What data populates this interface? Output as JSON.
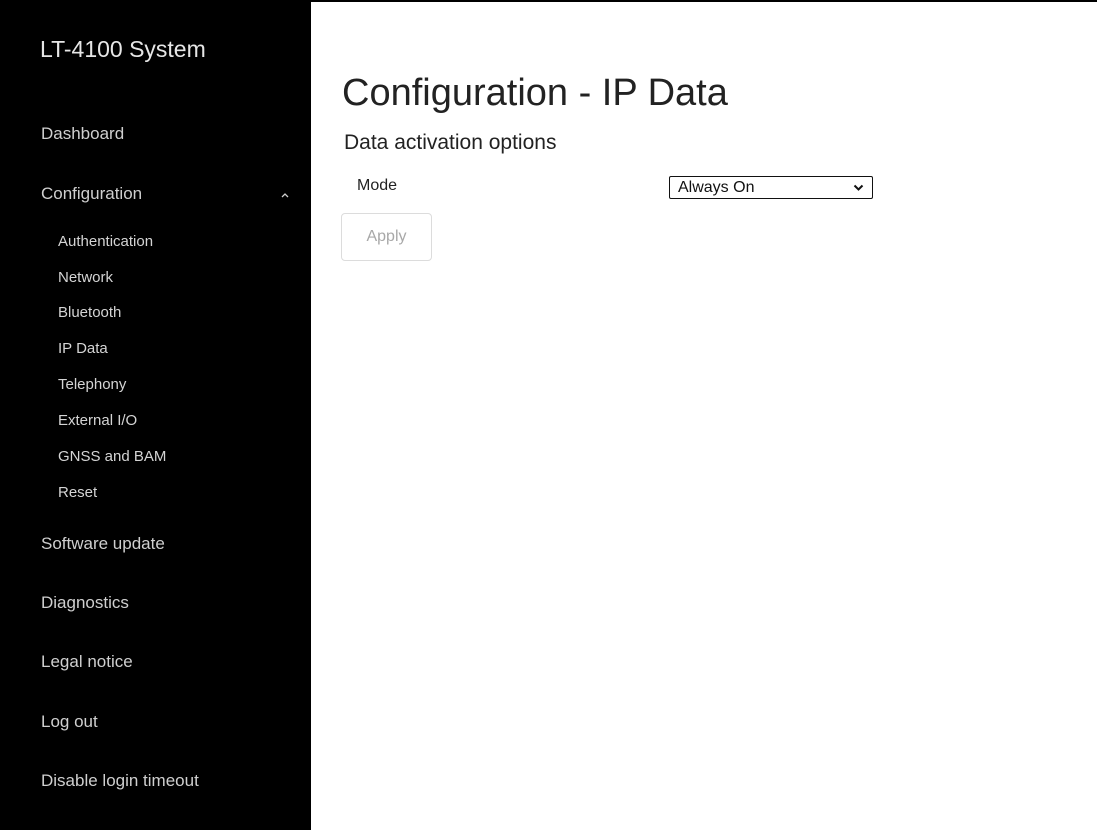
{
  "sidebar": {
    "brand": "LT-4100 System",
    "items": {
      "dashboard": "Dashboard",
      "configuration": "Configuration",
      "software_update": "Software update",
      "diagnostics": "Diagnostics",
      "legal_notice": "Legal notice",
      "log_out": "Log out",
      "disable_login_timeout": "Disable login timeout"
    },
    "configuration_sub": {
      "authentication": "Authentication",
      "network": "Network",
      "bluetooth": "Bluetooth",
      "ip_data": "IP Data",
      "telephony": "Telephony",
      "external_io": "External I/O",
      "gnss_bam": "GNSS and BAM",
      "reset": "Reset"
    },
    "configuration_expanded_icon": "chevron-up-icon"
  },
  "main": {
    "title": "Configuration - IP Data",
    "section_title": "Data activation options",
    "mode_label": "Mode",
    "mode_selected": "Always On",
    "mode_select_icon": "chevron-down-icon",
    "apply_label": "Apply"
  }
}
